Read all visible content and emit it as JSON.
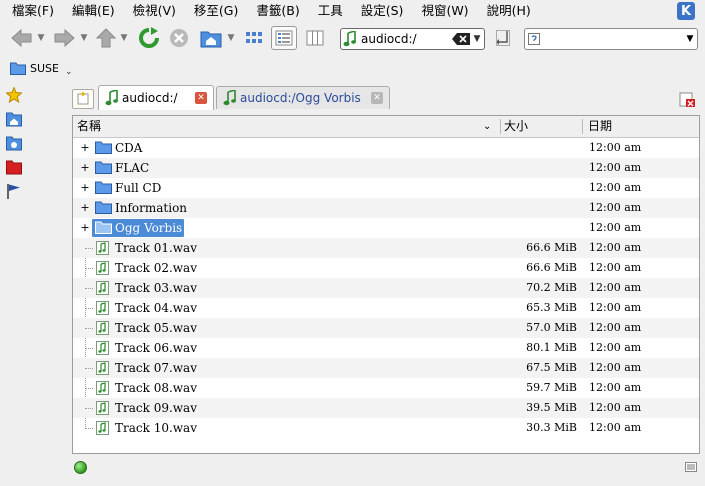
{
  "menu": {
    "items": [
      "檔案(F)",
      "編輯(E)",
      "檢視(V)",
      "移至(G)",
      "書籤(B)",
      "工具",
      "設定(S)",
      "視窗(W)",
      "說明(H)"
    ]
  },
  "toolbar": {
    "location_value": "audiocd:/",
    "search_placeholder": ""
  },
  "bookmarks": {
    "label": "SUSE"
  },
  "tabs": [
    {
      "label": "audiocd:/",
      "active": true
    },
    {
      "label": "audiocd:/Ogg Vorbis",
      "active": false
    }
  ],
  "columns": {
    "name": "名稱",
    "size": "大小",
    "date": "日期"
  },
  "folders": [
    {
      "name": "CDA",
      "date": "12:00 am",
      "selected": false
    },
    {
      "name": "FLAC",
      "date": "12:00 am",
      "selected": false
    },
    {
      "name": "Full CD",
      "date": "12:00 am",
      "selected": false
    },
    {
      "name": "Information",
      "date": "12:00 am",
      "selected": false
    },
    {
      "name": "Ogg Vorbis",
      "date": "12:00 am",
      "selected": true
    }
  ],
  "files": [
    {
      "name": "Track 01.wav",
      "size": "66.6 MiB",
      "date": "12:00 am"
    },
    {
      "name": "Track 02.wav",
      "size": "66.6 MiB",
      "date": "12:00 am"
    },
    {
      "name": "Track 03.wav",
      "size": "70.2 MiB",
      "date": "12:00 am"
    },
    {
      "name": "Track 04.wav",
      "size": "65.3 MiB",
      "date": "12:00 am"
    },
    {
      "name": "Track 05.wav",
      "size": "57.0 MiB",
      "date": "12:00 am"
    },
    {
      "name": "Track 06.wav",
      "size": "80.1 MiB",
      "date": "12:00 am"
    },
    {
      "name": "Track 07.wav",
      "size": "67.5 MiB",
      "date": "12:00 am"
    },
    {
      "name": "Track 08.wav",
      "size": "59.7 MiB",
      "date": "12:00 am"
    },
    {
      "name": "Track 09.wav",
      "size": "39.5 MiB",
      "date": "12:00 am"
    },
    {
      "name": "Track 10.wav",
      "size": "30.3 MiB",
      "date": "12:00 am"
    }
  ],
  "colors": {
    "selection": "#4a8ad6",
    "folder": "#4f8fe0",
    "reload_green": "#2f9a2f",
    "close_red": "#d8553b"
  }
}
